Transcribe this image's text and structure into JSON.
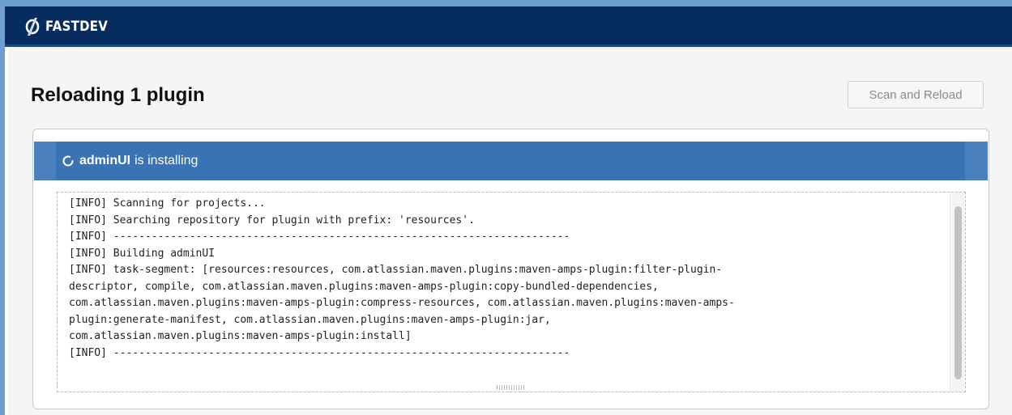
{
  "header": {
    "logo_text": "FASTDEV",
    "logo_icon": "lightning-slash-icon"
  },
  "page": {
    "title": "Reloading 1 plugin",
    "scan_button_label": "Scan and Reload"
  },
  "plugin_status": {
    "icon": "spinner-icon",
    "plugin_name": "adminUI",
    "status": "is installing"
  },
  "log": {
    "lines": [
      "[INFO] Scanning for projects...",
      "[INFO] Searching repository for plugin with prefix: 'resources'.",
      "[INFO] ------------------------------------------------------------------------",
      "[INFO] Building adminUI",
      "[INFO] task-segment: [resources:resources, com.atlassian.maven.plugins:maven-amps-plugin:filter-plugin-",
      "descriptor, compile, com.atlassian.maven.plugins:maven-amps-plugin:copy-bundled-dependencies,",
      "com.atlassian.maven.plugins:maven-amps-plugin:compress-resources, com.atlassian.maven.plugins:maven-amps-",
      "plugin:generate-manifest, com.atlassian.maven.plugins:maven-amps-plugin:jar,",
      "com.atlassian.maven.plugins:maven-amps-plugin:install]",
      "[INFO] ------------------------------------------------------------------------"
    ]
  },
  "colors": {
    "topbar": "#062d5e",
    "status_bar": "#3a73b5",
    "background": "#f5f5f5"
  }
}
